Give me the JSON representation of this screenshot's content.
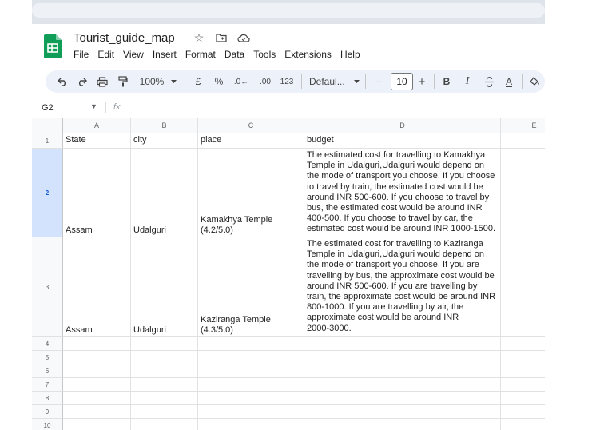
{
  "doc": {
    "title": "Tourist_guide_map"
  },
  "menu": [
    "File",
    "Edit",
    "View",
    "Insert",
    "Format",
    "Data",
    "Tools",
    "Extensions",
    "Help"
  ],
  "toolbar": {
    "zoom": "100%",
    "currency": "£",
    "percent": "%",
    "decrease_decimal": ".0←",
    "increase_decimal": ".00",
    "number_format": "123",
    "font": "Defaul...",
    "font_size": "10",
    "minus": "−",
    "plus": "+",
    "bold": "B",
    "italic": "I",
    "text_color": "A"
  },
  "formula_bar": {
    "name_box": "G2",
    "fx": "fx",
    "value": ""
  },
  "columns": [
    "A",
    "B",
    "C",
    "D",
    "E"
  ],
  "row_numbers": [
    "1",
    "2",
    "3",
    "4",
    "5",
    "6",
    "7",
    "8",
    "9",
    "10"
  ],
  "rows": [
    {
      "state": "State",
      "city": "city",
      "place": "place",
      "budget": "budget"
    },
    {
      "state": "Assam",
      "city": "Udalguri",
      "place": "Kamakhya Temple\n(4.2/5.0)",
      "budget": "The estimated cost for travelling to Kamakhya\nTemple in Udalguri,Udalguri would depend on\nthe mode of transport you choose. If you choose\nto travel by train, the estimated cost would be\naround INR 500-600. If you choose to travel by\nbus, the estimated cost would be around INR\n400-500. If you choose to travel by car, the\nestimated cost would be around INR 1000-1500."
    },
    {
      "state": "Assam",
      "city": "Udalguri",
      "place": "Kaziranga Temple\n(4.3/5.0)",
      "budget": "The estimated cost for travelling to Kaziranga\nTemple in Udalguri,Udalguri would depend on\nthe mode of transport you choose. If you are\ntravelling by bus, the approximate cost would be\naround INR 500-600. If you are travelling by\ntrain, the approximate cost would be around INR\n800-1000. If you are travelling by air, the\napproximate cost would be around INR\n2000-3000."
    }
  ]
}
